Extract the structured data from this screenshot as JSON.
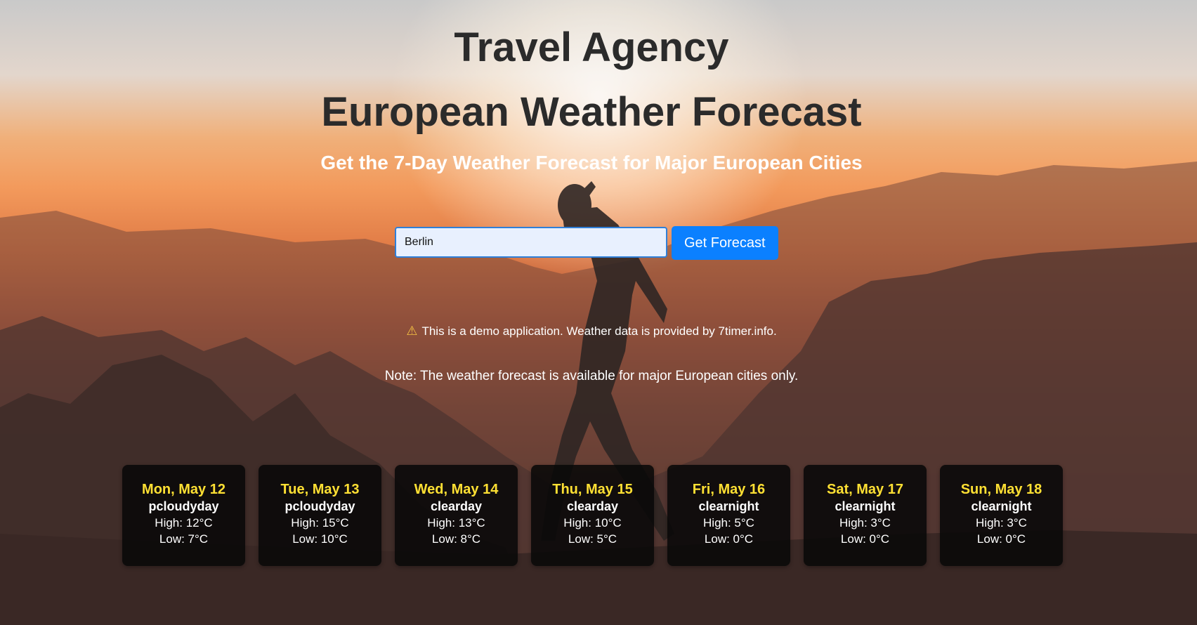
{
  "header": {
    "agency": "Travel Agency",
    "title": "European Weather Forecast",
    "subtitle": "Get the 7-Day Weather Forecast for Major European Cities"
  },
  "search": {
    "value": "Berlin",
    "button_label": "Get Forecast"
  },
  "disclaimer": {
    "icon": "warning-icon",
    "text": "This is a demo application. Weather data is provided by 7timer.info."
  },
  "note": "Note: The weather forecast is available for major European cities only.",
  "forecast": [
    {
      "day": "Mon, May 12",
      "condition": "pcloudyday",
      "high": "High: 12°C",
      "low": "Low: 7°C"
    },
    {
      "day": "Tue, May 13",
      "condition": "pcloudyday",
      "high": "High: 15°C",
      "low": "Low: 10°C"
    },
    {
      "day": "Wed, May 14",
      "condition": "clearday",
      "high": "High: 13°C",
      "low": "Low: 8°C"
    },
    {
      "day": "Thu, May 15",
      "condition": "clearday",
      "high": "High: 10°C",
      "low": "Low: 5°C"
    },
    {
      "day": "Fri, May 16",
      "condition": "clearnight",
      "high": "High: 5°C",
      "low": "Low: 0°C"
    },
    {
      "day": "Sat, May 17",
      "condition": "clearnight",
      "high": "High: 3°C",
      "low": "Low: 0°C"
    },
    {
      "day": "Sun, May 18",
      "condition": "clearnight",
      "high": "High: 3°C",
      "low": "Low: 0°C"
    }
  ],
  "colors": {
    "accent": "#0b80ff",
    "day_label": "#ffe033",
    "title": "#2b2b2b",
    "card_bg": "#080808"
  }
}
